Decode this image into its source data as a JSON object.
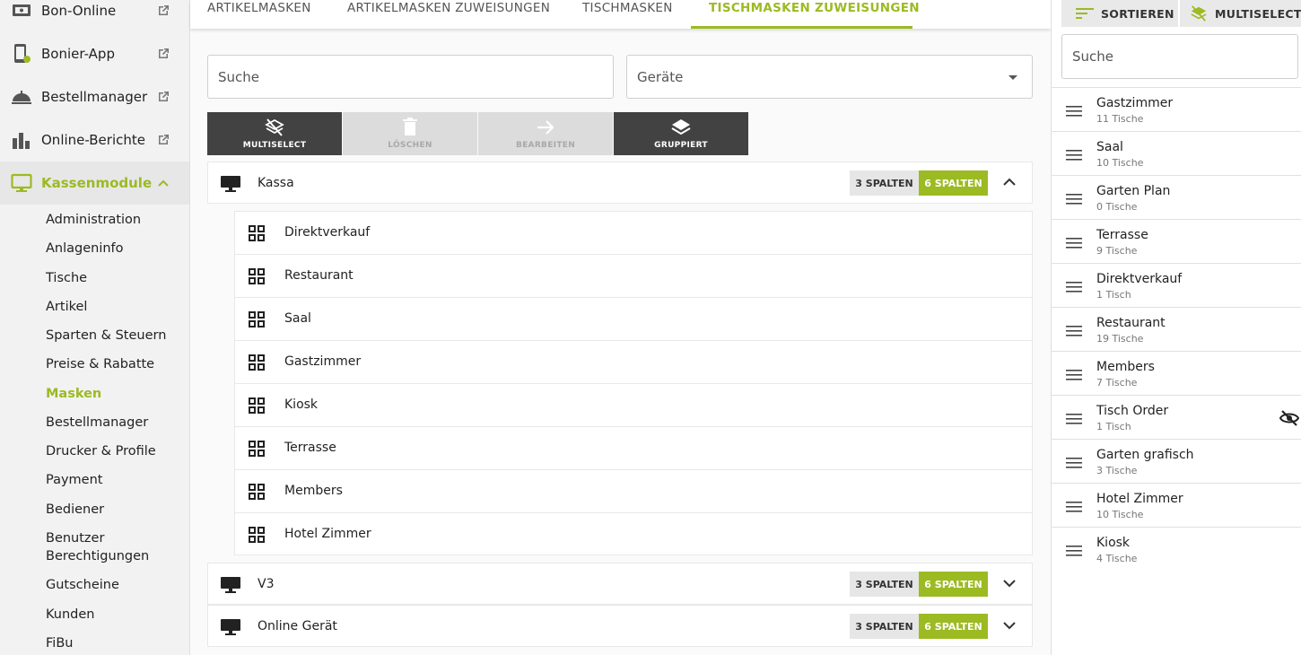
{
  "sidebar": {
    "links": [
      {
        "label": "Bon-Online",
        "icon": "bon-online-icon"
      },
      {
        "label": "Bonier-App",
        "icon": "tablet-icon"
      },
      {
        "label": "Bestellmanager",
        "icon": "cloche-icon"
      },
      {
        "label": "Online-Berichte",
        "icon": "bar-chart-icon"
      },
      {
        "label": "Kassenmodule",
        "icon": "monitor-icon"
      }
    ],
    "subitems": [
      "Administration",
      "Anlageninfo",
      "Tische",
      "Artikel",
      "Sparten & Steuern",
      "Preise & Rabatte",
      "Masken",
      "Bestellmanager",
      "Drucker & Profile",
      "Payment",
      "Bediener",
      "Benutzer",
      "Berechtigungen",
      "Gutscheine",
      "Kunden",
      "FiBu"
    ],
    "active_sub": "Masken",
    "accent": "#9cba22"
  },
  "tabs": [
    "ARTIKELMASKEN",
    "ARTIKELMASKEN ZUWEISUNGEN",
    "TISCHMASKEN",
    "TISCHMASKEN ZUWEISUNGEN"
  ],
  "filters": {
    "search": "Suche",
    "device": "Geräte"
  },
  "toolbar": {
    "multiselect": "MULTISELECT",
    "delete": "LÖSCHEN",
    "edit": "BEARBEITEN",
    "grouped": "GRUPPIERT"
  },
  "groups": [
    {
      "name": "Kassa",
      "col3": "3 SPALTEN",
      "col6": "6 SPALTEN",
      "expanded": true
    },
    {
      "name": "V3",
      "col3": "3 SPALTEN",
      "col6": "6 SPALTEN",
      "expanded": false
    },
    {
      "name": "Online Gerät",
      "col3": "3 SPALTEN",
      "col6": "6 SPALTEN",
      "expanded": false
    }
  ],
  "masks": [
    "Direktverkauf",
    "Restaurant",
    "Saal",
    "Gastzimmer",
    "Kiosk",
    "Terrasse",
    "Members",
    "Hotel Zimmer"
  ],
  "right": {
    "sort_label": "SORTIEREN",
    "multiselect_label": "MULTISELECT",
    "search": "Suche",
    "items": [
      {
        "title": "Gastzimmer",
        "sub": "11 Tische"
      },
      {
        "title": "Saal",
        "sub": "10 Tische"
      },
      {
        "title": "Garten Plan",
        "sub": "0 Tische"
      },
      {
        "title": "Terrasse",
        "sub": "9 Tische"
      },
      {
        "title": "Direktverkauf",
        "sub": "1 Tisch"
      },
      {
        "title": "Restaurant",
        "sub": "19 Tische"
      },
      {
        "title": "Members",
        "sub": "7 Tische"
      },
      {
        "title": "Tisch Order",
        "sub": "1 Tisch",
        "hidden_icon": "eye-off-icon"
      },
      {
        "title": "Garten grafisch",
        "sub": "3 Tische"
      },
      {
        "title": "Hotel Zimmer",
        "sub": "10 Tische"
      },
      {
        "title": "Kiosk",
        "sub": "4 Tische"
      }
    ]
  }
}
